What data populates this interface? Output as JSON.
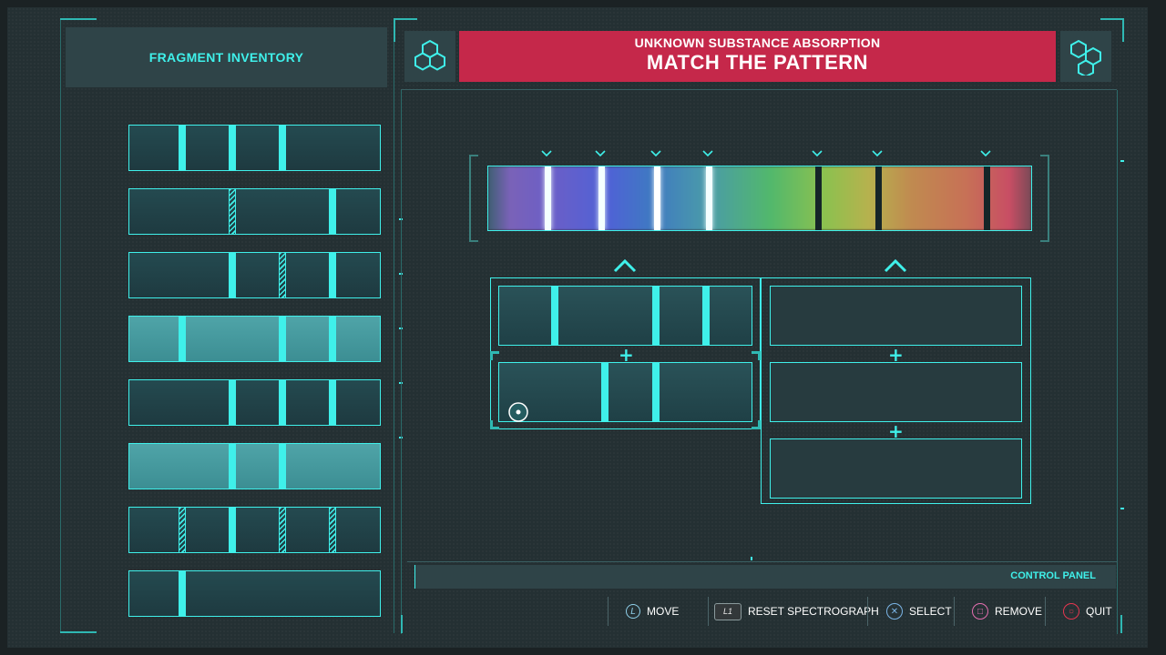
{
  "header": {
    "inventory_title": "FRAGMENT INVENTORY",
    "banner_subtitle": "UNKNOWN SUBSTANCE ABSORPTION",
    "banner_title": "MATCH THE PATTERN",
    "left_icon": "hexagon-molecule-icon",
    "right_icon": "hexagon-molecule-icon"
  },
  "fragments": [
    {
      "selected": false,
      "bars": [
        {
          "pos": 0.21,
          "hatch": false
        },
        {
          "pos": 0.41,
          "hatch": false
        },
        {
          "pos": 0.61,
          "hatch": false
        }
      ]
    },
    {
      "selected": false,
      "bars": [
        {
          "pos": 0.41,
          "hatch": true
        },
        {
          "pos": 0.81,
          "hatch": false
        }
      ]
    },
    {
      "selected": false,
      "bars": [
        {
          "pos": 0.41,
          "hatch": false
        },
        {
          "pos": 0.61,
          "hatch": true
        },
        {
          "pos": 0.81,
          "hatch": false
        }
      ]
    },
    {
      "selected": true,
      "bars": [
        {
          "pos": 0.21,
          "hatch": false
        },
        {
          "pos": 0.61,
          "hatch": false
        },
        {
          "pos": 0.81,
          "hatch": false
        }
      ]
    },
    {
      "selected": false,
      "bars": [
        {
          "pos": 0.41,
          "hatch": false
        },
        {
          "pos": 0.61,
          "hatch": false
        },
        {
          "pos": 0.81,
          "hatch": false
        }
      ]
    },
    {
      "selected": true,
      "bars": [
        {
          "pos": 0.41,
          "hatch": false
        },
        {
          "pos": 0.61,
          "hatch": false
        }
      ]
    },
    {
      "selected": false,
      "bars": [
        {
          "pos": 0.21,
          "hatch": true
        },
        {
          "pos": 0.41,
          "hatch": false
        },
        {
          "pos": 0.61,
          "hatch": true
        },
        {
          "pos": 0.81,
          "hatch": true
        }
      ]
    },
    {
      "selected": false,
      "bars": [
        {
          "pos": 0.21,
          "hatch": false
        }
      ]
    }
  ],
  "spectrograph": {
    "markers": [
      0.108,
      0.208,
      0.31,
      0.405,
      0.605,
      0.715,
      0.915
    ],
    "lines": [
      {
        "pos": 0.108,
        "color": "#f4ffff"
      },
      {
        "pos": 0.208,
        "color": "#f4ffff"
      },
      {
        "pos": 0.31,
        "color": "#ffffff"
      },
      {
        "pos": 0.405,
        "color": "#f4ffff"
      },
      {
        "pos": 0.605,
        "color": "#152528"
      },
      {
        "pos": 0.715,
        "color": "#152528"
      },
      {
        "pos": 0.915,
        "color": "#152528"
      }
    ]
  },
  "slots": {
    "left_top_bars": [
      0.22,
      0.62,
      0.82
    ],
    "left_bottom_bars": [
      0.42,
      0.62
    ]
  },
  "controls": {
    "panel_title": "CONTROL PANEL",
    "move": {
      "key": "L",
      "label": "MOVE"
    },
    "reset": {
      "key": "L1",
      "label": "RESET SPECTROGRAPH"
    },
    "select": {
      "key": "✕",
      "label": "SELECT"
    },
    "remove": {
      "key": "□",
      "label": "REMOVE"
    },
    "quit": {
      "key": "○",
      "label": "QUIT"
    }
  },
  "colors": {
    "accent": "#3ff0ea",
    "banner": "#c5284a",
    "select_button": "#7bb5e6",
    "remove_button": "#e46fb0",
    "quit_button": "#e5364f"
  }
}
